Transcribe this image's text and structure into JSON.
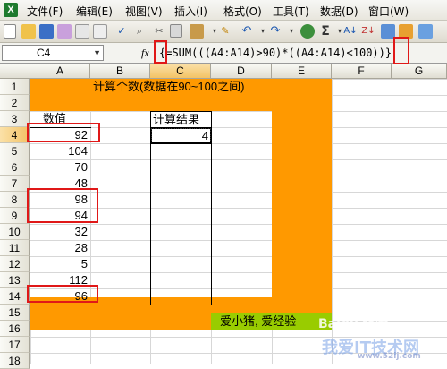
{
  "menubar": {
    "app_icon_letter": "X",
    "items": [
      "文件(F)",
      "编辑(E)",
      "视图(V)",
      "插入(I)",
      "格式(O)",
      "工具(T)",
      "数据(D)",
      "窗口(W)"
    ]
  },
  "formula_bar": {
    "name_box": "C4",
    "fx": "fx",
    "formula": "{=SUM(((A4:A14)>90)*((A4:A14)<100))}"
  },
  "columns": [
    "A",
    "B",
    "C",
    "D",
    "E",
    "F",
    "G"
  ],
  "rows": [
    "1",
    "2",
    "3",
    "4",
    "5",
    "6",
    "7",
    "8",
    "9",
    "10",
    "11",
    "12",
    "13",
    "14",
    "15",
    "16",
    "17",
    "18"
  ],
  "sheet": {
    "title": "计算个数(数据在90~100之间)",
    "a_header": "数值",
    "c_header": "计算结果",
    "values": [
      "92",
      "104",
      "70",
      "48",
      "98",
      "94",
      "32",
      "28",
      "5",
      "112",
      "96"
    ],
    "result": "4",
    "footer": "爱小猪, 爱经验"
  },
  "watermark": {
    "baidu": "Baidu 经验",
    "site": "我爱IT技术网",
    "url": "www.52ij.com"
  },
  "colors": {
    "orange": "#ff9900",
    "green": "#99cc00",
    "highlight_red": "#e01818"
  }
}
